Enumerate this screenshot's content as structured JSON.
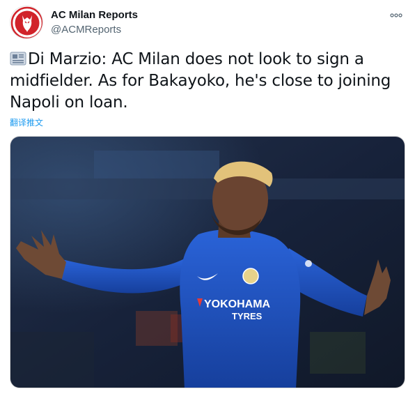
{
  "author": {
    "display_name": "AC Milan Reports",
    "handle": "@ACMReports"
  },
  "tweet": {
    "text": "Di Marzio: AC Milan does not look to sign a midfielder. As for Bakayoko, he's close to joining Napoli on loan.",
    "translate_label": "翻译推文"
  },
  "media": {
    "alt": "Bakayoko in Chelsea kit, arms spread",
    "shirt_sponsor_line1": "YOKOHAMA",
    "shirt_sponsor_line2": "TYRES"
  },
  "icons": {
    "more": "more-options-icon",
    "newspaper": "newspaper-icon",
    "avatar": "milan-devil-logo"
  },
  "colors": {
    "accent": "#1d9bf0",
    "text": "#0f1419",
    "secondary": "#536471",
    "logo_red": "#d1232a",
    "kit_blue": "#1c4fbf"
  }
}
